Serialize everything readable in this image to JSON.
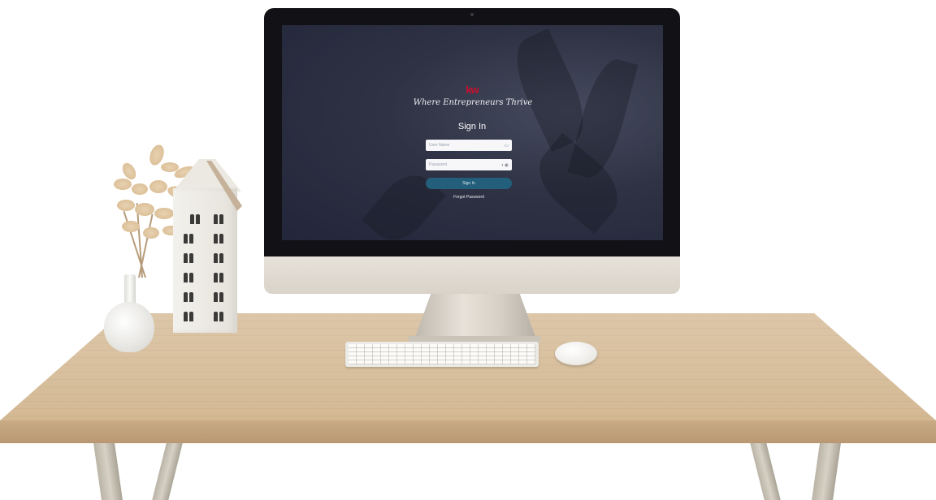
{
  "screen": {
    "logo_text": "kw",
    "tagline": "Where Entrepreneurs Thrive",
    "title": "Sign In",
    "username": {
      "value": "",
      "placeholder": "User Name",
      "icon": "id-card-icon"
    },
    "password": {
      "value": "",
      "placeholder": "Password",
      "icon": "eye-toggle-icon"
    },
    "signin_button": {
      "label": "Sign In"
    },
    "forgot_link": "Forgot Password"
  },
  "colors": {
    "brand_red": "#c8102e",
    "button_blue": "#235f7a",
    "screen_bg": "#2a2d3f"
  }
}
